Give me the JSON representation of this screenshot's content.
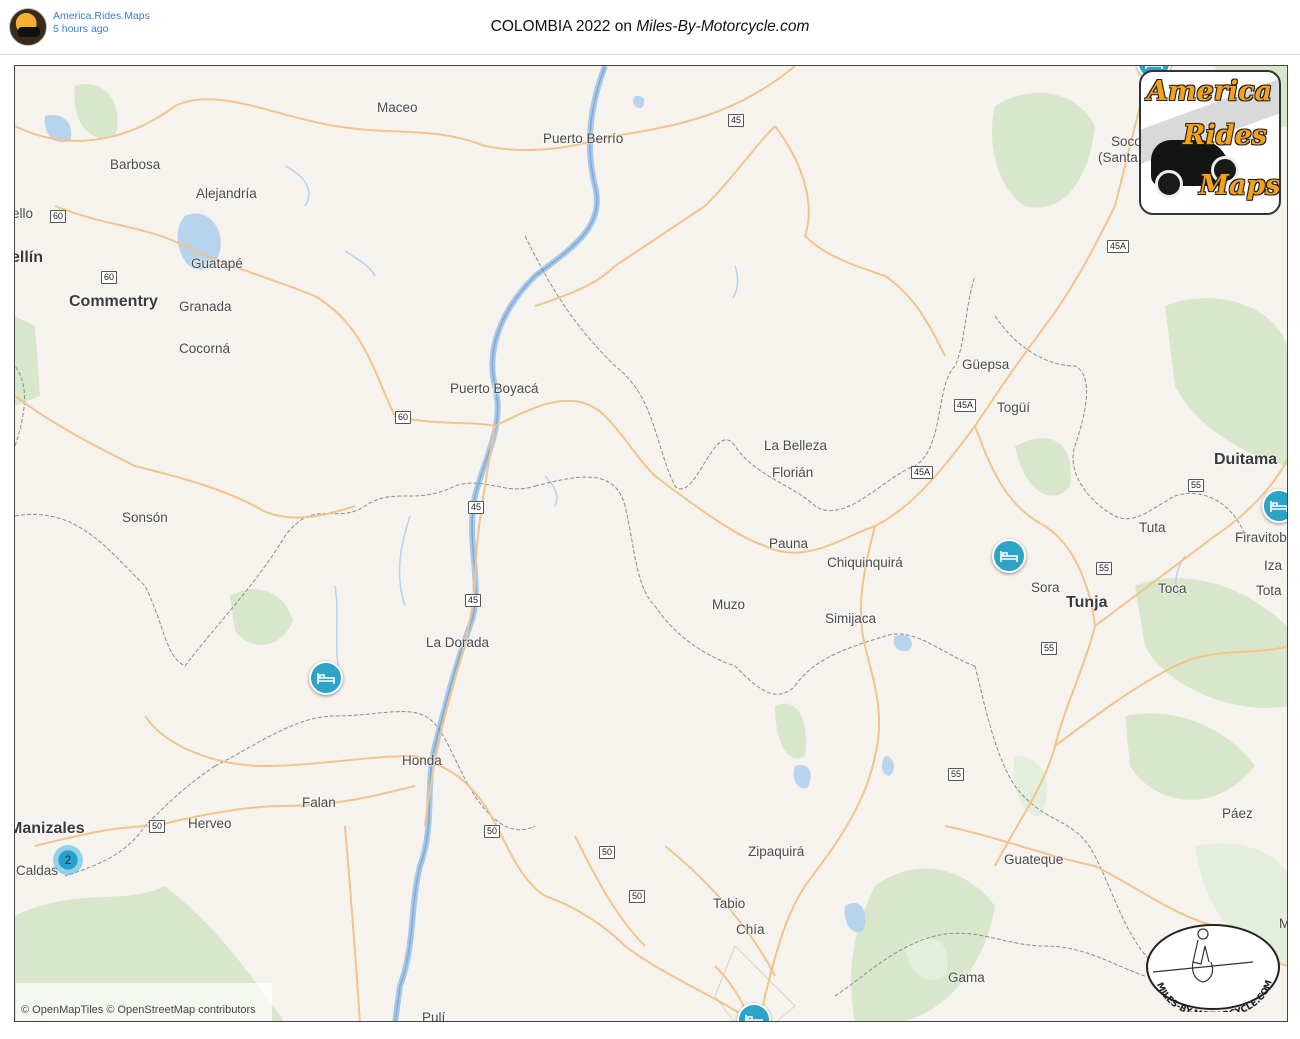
{
  "post": {
    "author": "America.Rides.Maps",
    "time_ago": "5 hours ago",
    "title_prefix": "COLOMBIA 2022 on ",
    "title_site": "Miles-By-Motorcycle.com"
  },
  "logo": {
    "line1": "America",
    "line2": "Rides",
    "line3": "Maps",
    "round_text": "MILES-BY-MOTORCYCLE.COM"
  },
  "attribution": "© OpenMapTiles © OpenStreetMap contributors",
  "places": [
    {
      "id": "maceo",
      "label": "Maceo"
    },
    {
      "id": "puerto-berrio",
      "label": "Puerto Berrío"
    },
    {
      "id": "barbosa",
      "label": "Barbosa"
    },
    {
      "id": "alejandria",
      "label": "Alejandría"
    },
    {
      "id": "bello",
      "label": "Bello"
    },
    {
      "id": "medellin",
      "label": "ellín"
    },
    {
      "id": "guatape",
      "label": "Guatapé"
    },
    {
      "id": "commentry",
      "label": "Commentry"
    },
    {
      "id": "granada",
      "label": "Granada"
    },
    {
      "id": "cocorna",
      "label": "Cocorná"
    },
    {
      "id": "puerto-boyaca",
      "label": "Puerto Boyacá"
    },
    {
      "id": "la-belleza",
      "label": "La Belleza"
    },
    {
      "id": "florian",
      "label": "Florián"
    },
    {
      "id": "guepsa",
      "label": "Güepsa"
    },
    {
      "id": "togui",
      "label": "Togüí"
    },
    {
      "id": "socorro",
      "label": "Soco"
    },
    {
      "id": "santander",
      "label": "(Santa"
    },
    {
      "id": "duitama",
      "label": "Duitama"
    },
    {
      "id": "tuta",
      "label": "Tuta"
    },
    {
      "id": "firavitoba",
      "label": "Firavitob"
    },
    {
      "id": "iza",
      "label": "Iza"
    },
    {
      "id": "tota",
      "label": "Tota"
    },
    {
      "id": "sonson",
      "label": "Sonsón"
    },
    {
      "id": "pauna",
      "label": "Pauna"
    },
    {
      "id": "chiquinquira",
      "label": "Chiquinquirá"
    },
    {
      "id": "sora",
      "label": "Sora"
    },
    {
      "id": "tunja",
      "label": "Tunja"
    },
    {
      "id": "toca",
      "label": "Toca"
    },
    {
      "id": "muzo",
      "label": "Muzo"
    },
    {
      "id": "simijaca",
      "label": "Simijaca"
    },
    {
      "id": "la-dorada",
      "label": "La Dorada"
    },
    {
      "id": "honda",
      "label": "Honda"
    },
    {
      "id": "falan",
      "label": "Falan"
    },
    {
      "id": "manizales",
      "label": "Manizales"
    },
    {
      "id": "herveo",
      "label": "Herveo"
    },
    {
      "id": "caldas",
      "label": "Caldas"
    },
    {
      "id": "paez",
      "label": "Páez"
    },
    {
      "id": "zipaquira",
      "label": "Zipaquirá"
    },
    {
      "id": "guateque",
      "label": "Guateque"
    },
    {
      "id": "tabio",
      "label": "Tabio"
    },
    {
      "id": "chia",
      "label": "Chía"
    },
    {
      "id": "gama",
      "label": "Gama"
    },
    {
      "id": "puli",
      "label": "Pulí"
    },
    {
      "id": "m-edge",
      "label": "M"
    }
  ],
  "shields": [
    {
      "id": "r45-top",
      "label": "45"
    },
    {
      "id": "r60-a",
      "label": "60"
    },
    {
      "id": "r60-b",
      "label": "60"
    },
    {
      "id": "r60-c",
      "label": "60"
    },
    {
      "id": "r45a-a",
      "label": "45A"
    },
    {
      "id": "r45a-b",
      "label": "45A"
    },
    {
      "id": "r45a-c",
      "label": "45A"
    },
    {
      "id": "r55-a",
      "label": "55"
    },
    {
      "id": "r55-b",
      "label": "55"
    },
    {
      "id": "r55-c",
      "label": "55"
    },
    {
      "id": "r55-d",
      "label": "55"
    },
    {
      "id": "r45-mid",
      "label": "45"
    },
    {
      "id": "r45-low",
      "label": "45"
    },
    {
      "id": "r50-a",
      "label": "50"
    },
    {
      "id": "r50-b",
      "label": "50"
    },
    {
      "id": "r50-c",
      "label": "50"
    },
    {
      "id": "r50-d",
      "label": "50"
    }
  ],
  "markers": [
    {
      "id": "lodging-1",
      "icon": "bed-icon"
    },
    {
      "id": "lodging-2",
      "icon": "bed-icon"
    },
    {
      "id": "lodging-3",
      "icon": "bed-icon"
    },
    {
      "id": "lodging-4",
      "icon": "bed-icon"
    },
    {
      "id": "lodging-5",
      "icon": "bed-icon"
    }
  ],
  "cluster": {
    "count": "2"
  },
  "colors": {
    "land": "#f6f3ef",
    "road": "#f5c78a",
    "river": "#a8c8e8",
    "forest": "#cfe2c0",
    "border": "#8a8a8a",
    "marker": "#2ea3c8"
  }
}
